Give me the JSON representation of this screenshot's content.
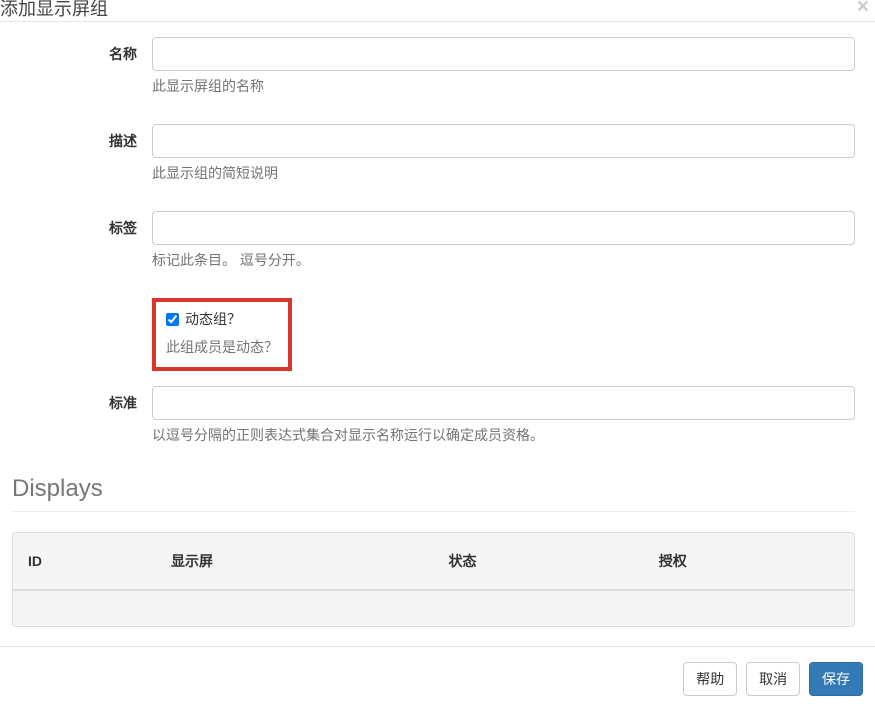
{
  "header": {
    "title": "添加显示屏组"
  },
  "form": {
    "name": {
      "label": "名称",
      "value": "",
      "help": "此显示屏组的名称"
    },
    "desc": {
      "label": "描述",
      "value": "",
      "help": "此显示组的简短说明"
    },
    "tags": {
      "label": "标签",
      "value": "",
      "help": "标记此条目。 逗号分开。"
    },
    "dynamic": {
      "label": "动态组？",
      "checked": true,
      "help": "此组成员是动态？"
    },
    "criteria": {
      "label": "标准",
      "value": "",
      "help": "以逗号分隔的正则表达式集合对显示名称运行以确定成员资格。"
    }
  },
  "section": {
    "displays": "Displays"
  },
  "table": {
    "headers": {
      "id": "ID",
      "display": "显示屏",
      "status": "状态",
      "auth": "授权"
    },
    "rows": []
  },
  "footer": {
    "help": "帮助",
    "cancel": "取消",
    "save": "保存"
  }
}
